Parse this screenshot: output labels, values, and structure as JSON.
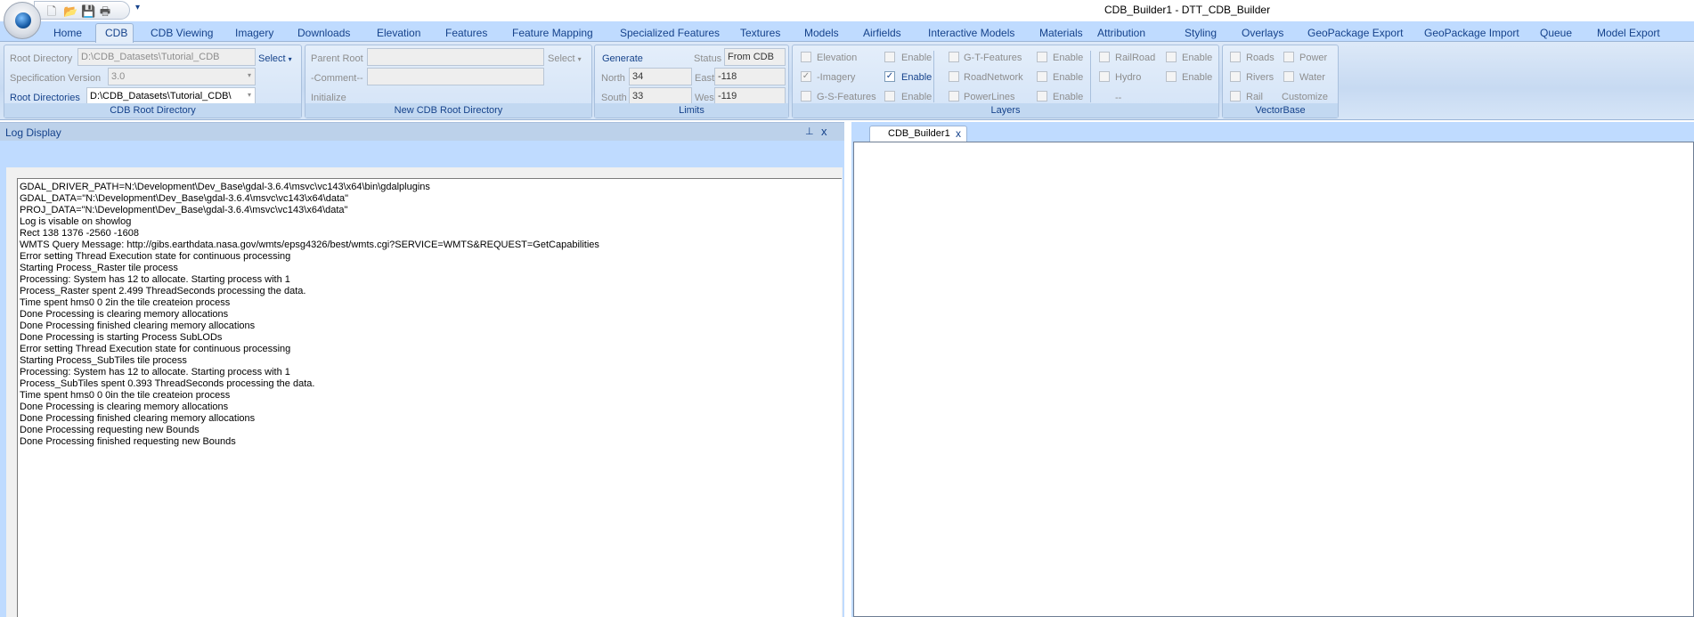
{
  "window": {
    "title": "CDB_Builder1 - DTT_CDB_Builder"
  },
  "quick_access": {
    "icons": [
      "new-file-icon",
      "open-folder-icon",
      "save-icon",
      "print-icon"
    ],
    "customize": "▾"
  },
  "tabs": [
    {
      "label": "Home"
    },
    {
      "label": "CDB",
      "active": true
    },
    {
      "label": "CDB Viewing"
    },
    {
      "label": "Imagery"
    },
    {
      "label": "Downloads"
    },
    {
      "label": "Elevation"
    },
    {
      "label": "Features"
    },
    {
      "label": "Feature Mapping"
    },
    {
      "label": "Specialized Features"
    },
    {
      "label": "Textures"
    },
    {
      "label": "Models"
    },
    {
      "label": "Airfields"
    },
    {
      "label": "Interactive Models"
    },
    {
      "label": "Materials"
    },
    {
      "label": "Attribution"
    },
    {
      "label": "Styling"
    },
    {
      "label": "Overlays"
    },
    {
      "label": "GeoPackage Export"
    },
    {
      "label": "GeoPackage Import"
    },
    {
      "label": "Queue"
    },
    {
      "label": "Model Export"
    }
  ],
  "ribbon": {
    "cdb_root": {
      "title": "CDB Root Directory",
      "root_dir_label": "Root Directory",
      "root_dir_value": "D:\\CDB_Datasets\\Tutorial_CDB",
      "select": "Select",
      "spec_label": "Specification Version",
      "spec_value": "3.0",
      "root_dirs_label": "Root Directories",
      "root_dirs_value": "D:\\CDB_Datasets\\Tutorial_CDB\\"
    },
    "new_root": {
      "title": "New CDB Root Directory",
      "parent_label": "Parent Root",
      "parent_value": "",
      "select": "Select",
      "comment_label": "-Comment--",
      "comment_value": "",
      "initialize": "Initialize"
    },
    "limits": {
      "title": "Limits",
      "generate": "Generate",
      "status_label": "Status",
      "status_value": "From CDB",
      "north_label": "North",
      "north": "34",
      "east_label": "East",
      "east": "-118",
      "south_label": "South",
      "south": "33",
      "west_label": "West",
      "west": "-119"
    },
    "layers": {
      "title": "Layers",
      "items": [
        {
          "label": "Elevation",
          "checked": false,
          "enable": "Enable",
          "enabled": false
        },
        {
          "label": "-Imagery",
          "checked": true,
          "enable": "Enable",
          "enabled": true
        },
        {
          "label": "G-S-Features",
          "checked": false,
          "enable": "Enable",
          "enabled": false
        },
        {
          "label": "G-T-Features",
          "checked": false,
          "enable": "Enable",
          "enabled": false
        },
        {
          "label": "RoadNetwork",
          "checked": false,
          "enable": "Enable",
          "enabled": false
        },
        {
          "label": "PowerLines",
          "checked": false,
          "enable": "Enable",
          "enabled": false
        },
        {
          "label": "RailRoad",
          "checked": false,
          "enable": "Enable",
          "enabled": false
        },
        {
          "label": "Hydro",
          "checked": false,
          "enable": "Enable",
          "enabled": false
        }
      ],
      "extra": "--"
    },
    "vectorbase": {
      "title": "VectorBase",
      "roads": "Roads",
      "power": "Power",
      "rivers": "Rivers",
      "water": "Water",
      "rail": "Rail",
      "customize": "Customize"
    }
  },
  "log_panel": {
    "title": "Log Display",
    "lines": [
      "GDAL_DRIVER_PATH=N:\\Development\\Dev_Base\\gdal-3.6.4\\msvc\\vc143\\x64\\bin\\gdalplugins",
      "GDAL_DATA=\"N:\\Development\\Dev_Base\\gdal-3.6.4\\msvc\\vc143\\x64\\data\"",
      "PROJ_DATA=\"N:\\Development\\Dev_Base\\gdal-3.6.4\\msvc\\vc143\\x64\\data\"",
      "Log is visable on showlog",
      "Rect 138 1376 -2560 -1608",
      "WMTS Query Message: http://gibs.earthdata.nasa.gov/wmts/epsg4326/best/wmts.cgi?SERVICE=WMTS&REQUEST=GetCapabilities",
      "Error setting Thread Execution state for continuous processing",
      "Starting Process_Raster tile process",
      "Processing: System has 12 to allocate. Starting process with 1",
      "Process_Raster spent 2.499 ThreadSeconds processing the data.",
      "Time spent hms0 0 2in the tile createion process",
      "Done Processing is clearing memory allocations",
      "Done Processing finished clearing memory allocations",
      "Done Processing is starting Process SubLODs",
      "Error setting Thread Execution state for continuous processing",
      "Starting Process_SubTiles tile process",
      "Processing: System has 12 to allocate. Starting process with 1",
      "Process_SubTiles spent 0.393 ThreadSeconds processing the data.",
      "Time spent hms0 0 0in the tile createion process",
      "Done Processing is clearing memory allocations",
      "Done Processing finished clearing memory allocations",
      "Done Processing requesting new Bounds",
      "Done Processing finished requesting new Bounds"
    ]
  },
  "document": {
    "tab_label": "CDB_Builder1"
  },
  "glyphs": {
    "pin": "⊥",
    "close": "x",
    "check": "✓",
    "dropdown": "▾"
  }
}
